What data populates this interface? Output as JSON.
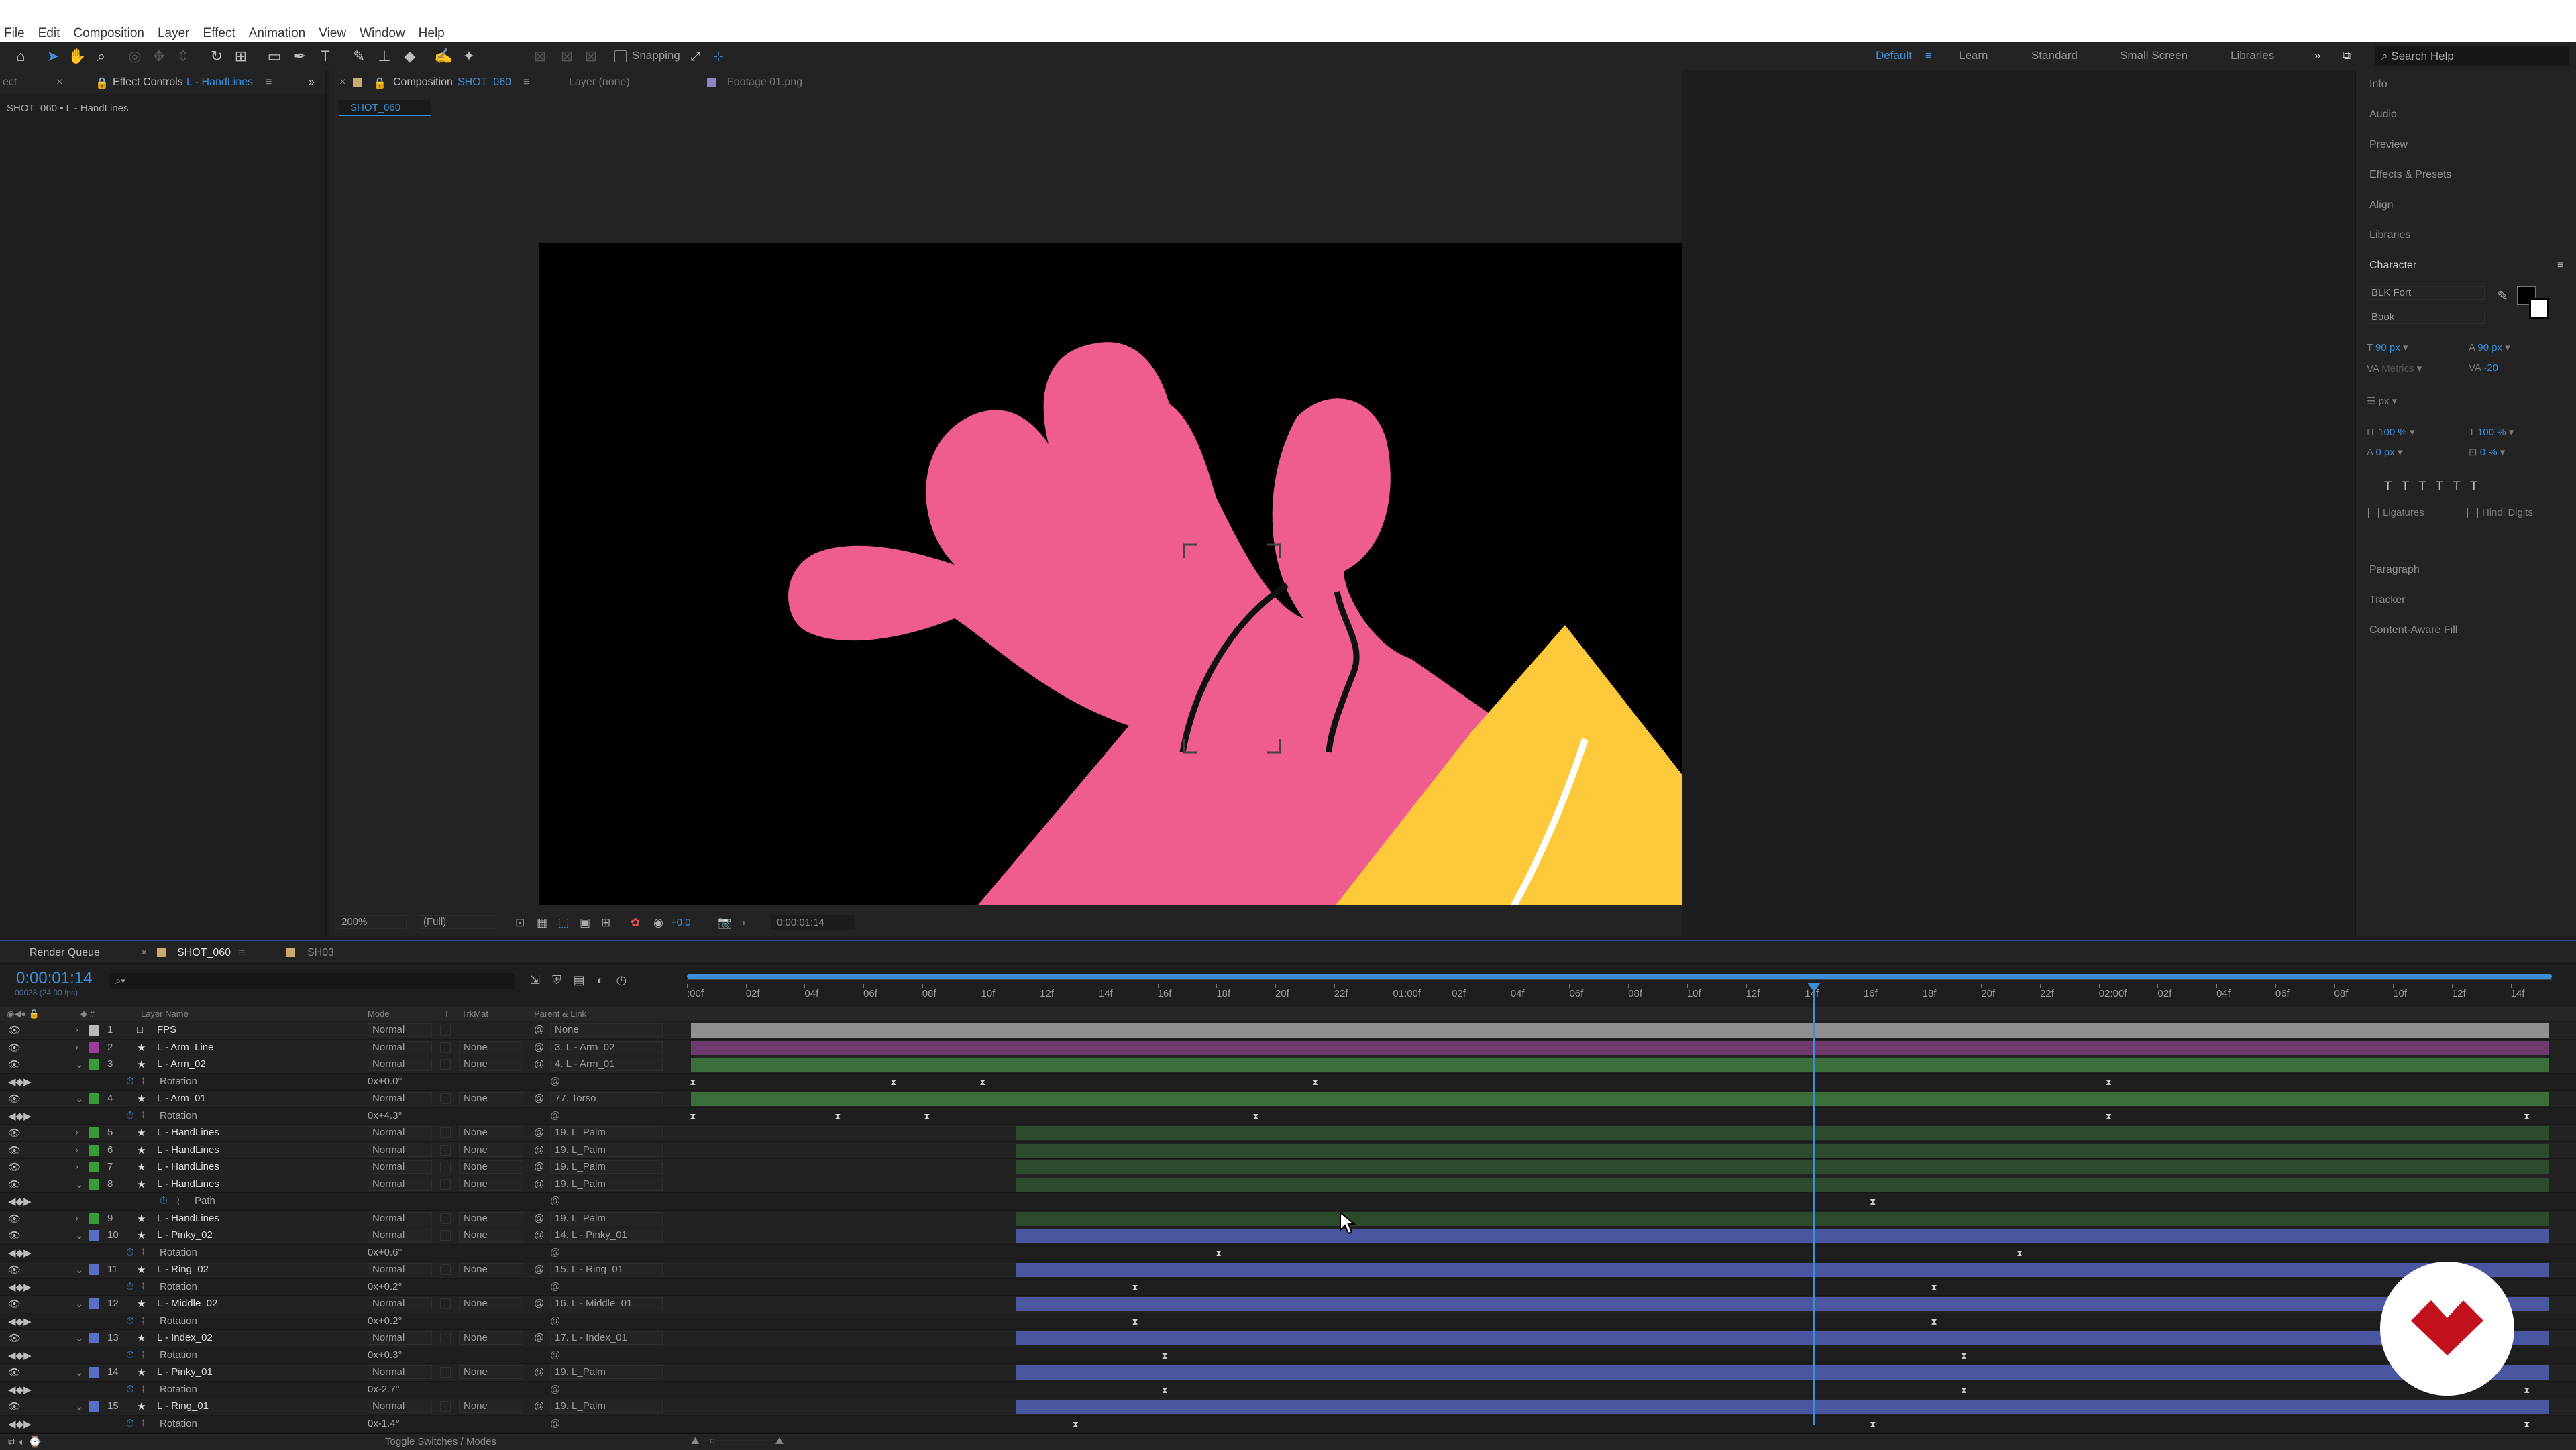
{
  "menu": [
    "File",
    "Edit",
    "Composition",
    "Layer",
    "Effect",
    "Animation",
    "View",
    "Window",
    "Help"
  ],
  "toolbar": {
    "snapping": "Snapping"
  },
  "workspaces": {
    "active": "Default",
    "items": [
      "Learn",
      "Standard",
      "Small Screen",
      "Libraries"
    ]
  },
  "search": {
    "placeholder": "Search Help"
  },
  "left": {
    "tab_prefix": "ect",
    "tab": "Effect Controls",
    "tab_layer": "L - HandLines",
    "breadcrumb": "SHOT_060 • L - HandLines"
  },
  "comp": {
    "tab_label": "Composition",
    "tab_name": "SHOT_060",
    "layer_tab": "Layer (none)",
    "footage_tab": "Footage 01.png",
    "subtab": "SHOT_060",
    "zoom": "200%",
    "quality": "(Full)",
    "exposure": "+0.0",
    "timecode": "0:00:01:14"
  },
  "right": {
    "items": [
      "Info",
      "Audio",
      "Preview",
      "Effects & Presets",
      "Align",
      "Libraries"
    ],
    "character": "Character",
    "font": "BLK Fort",
    "style": "Book",
    "size": "90 px",
    "leading": "90 px",
    "kerning": "Metrics",
    "tracking": "-20",
    "unit": "px",
    "vscale": "100 %",
    "hscale": "100 %",
    "baseline": "0 px",
    "tsume": "0 %",
    "ligatures": "Ligatures",
    "hindi": "Hindi Digits",
    "bottom": [
      "Paragraph",
      "Tracker",
      "Content-Aware Fill"
    ]
  },
  "timeline": {
    "render_queue": "Render Queue",
    "comp_tab": "SHOT_060",
    "other_tab": "SH03",
    "time": "0:00:01:14",
    "fps": "00038 (24.00 fps)",
    "headers": {
      "name": "Layer Name",
      "mode": "Mode",
      "t": "T",
      "trkmat": "TrkMat",
      "parent": "Parent & Link"
    },
    "ticks": [
      ":00f",
      "02f",
      "04f",
      "06f",
      "08f",
      "10f",
      "12f",
      "14f",
      "16f",
      "18f",
      "20f",
      "22f",
      "01:00f",
      "02f",
      "04f",
      "06f",
      "08f",
      "10f",
      "12f",
      "14f",
      "16f",
      "18f",
      "20f",
      "22f",
      "02:00f",
      "02f",
      "04f",
      "06f",
      "08f",
      "10f",
      "12f",
      "14f"
    ],
    "toggle_label": "Toggle Switches / Modes",
    "rows": [
      {
        "num": "1",
        "name": "FPS",
        "mode": "Normal",
        "trk": "",
        "parent": "None",
        "color": "#b9b9b9",
        "bar": "#8f8f8f",
        "barStart": 0,
        "type": "layer",
        "solid": true
      },
      {
        "num": "2",
        "name": "L - Arm_Line",
        "mode": "Normal",
        "trk": "None",
        "parent": "3. L - Arm_02",
        "color": "#9b3c9b",
        "bar": "#6e3a6e",
        "barStart": 0,
        "type": "layer"
      },
      {
        "num": "3",
        "name": "L - Arm_02",
        "mode": "Normal",
        "trk": "None",
        "parent": "4. L - Arm_01",
        "color": "#3a9a3a",
        "bar": "#3c6e3c",
        "barStart": 0,
        "type": "layer",
        "open": true
      },
      {
        "name": "Rotation",
        "value": "0x+0.0°",
        "type": "prop",
        "keys": [
          0.1,
          10.9,
          15.7,
          33.6,
          76.3
        ]
      },
      {
        "num": "4",
        "name": "L - Arm_01",
        "mode": "Normal",
        "trk": "None",
        "parent": "77. Torso",
        "color": "#3a9a3a",
        "bar": "#3c6e3c",
        "barStart": 0,
        "type": "layer",
        "open": true
      },
      {
        "name": "Rotation",
        "value": "0x+4.3°",
        "type": "prop",
        "keys": [
          0.1,
          7.9,
          12.7,
          30.4,
          76.3,
          98.8
        ]
      },
      {
        "num": "5",
        "name": "L - HandLines",
        "mode": "Normal",
        "trk": "None",
        "parent": "19. L_Palm",
        "color": "#3a9a3a",
        "bar": "#2d4a2d",
        "barStart": 17.5,
        "type": "layer"
      },
      {
        "num": "6",
        "name": "L - HandLines",
        "mode": "Normal",
        "trk": "None",
        "parent": "19. L_Palm",
        "color": "#3a9a3a",
        "bar": "#2d4a2d",
        "barStart": 17.5,
        "type": "layer"
      },
      {
        "num": "7",
        "name": "L - HandLines",
        "mode": "Normal",
        "trk": "None",
        "parent": "19. L_Palm",
        "color": "#3a9a3a",
        "bar": "#2d4a2d",
        "barStart": 17.5,
        "type": "layer"
      },
      {
        "num": "8",
        "name": "L - HandLines",
        "mode": "Normal",
        "trk": "None",
        "parent": "19. L_Palm",
        "color": "#3a9a3a",
        "bar": "#2d4a2d",
        "barStart": 17.5,
        "type": "layer",
        "open": true
      },
      {
        "name": "Path",
        "value": "",
        "type": "prop",
        "keys": [
          63.6
        ],
        "indent": true
      },
      {
        "num": "9",
        "name": "L - HandLines",
        "mode": "Normal",
        "trk": "None",
        "parent": "19. L_Palm",
        "color": "#3a9a3a",
        "bar": "#2d4a2d",
        "barStart": 17.5,
        "type": "layer"
      },
      {
        "num": "10",
        "name": "L - Pinky_02",
        "mode": "Normal",
        "trk": "None",
        "parent": "14. L - Pinky_01",
        "color": "#5a6ec8",
        "bar": "#4a57a0",
        "barStart": 17.5,
        "type": "layer",
        "open": true
      },
      {
        "name": "Rotation",
        "value": "0x+0.6°",
        "type": "prop",
        "keys": [
          28.4,
          71.5
        ]
      },
      {
        "num": "11",
        "name": "L - Ring_02",
        "mode": "Normal",
        "trk": "None",
        "parent": "15. L - Ring_01",
        "color": "#5a6ec8",
        "bar": "#4a57a0",
        "barStart": 17.5,
        "type": "layer",
        "open": true
      },
      {
        "name": "Rotation",
        "value": "0x+0.2°",
        "type": "prop",
        "keys": [
          23.9,
          66.9
        ]
      },
      {
        "num": "12",
        "name": "L - Middle_02",
        "mode": "Normal",
        "trk": "None",
        "parent": "16. L - Middle_01",
        "color": "#5a6ec8",
        "bar": "#4a57a0",
        "barStart": 17.5,
        "type": "layer",
        "open": true
      },
      {
        "name": "Rotation",
        "value": "0x+0.2°",
        "type": "prop",
        "keys": [
          23.9,
          66.9
        ]
      },
      {
        "num": "13",
        "name": "L - Index_02",
        "mode": "Normal",
        "trk": "None",
        "parent": "17. L - Index_01",
        "color": "#5a6ec8",
        "bar": "#4a57a0",
        "barStart": 17.5,
        "type": "layer",
        "open": true
      },
      {
        "name": "Rotation",
        "value": "0x+0.3°",
        "type": "prop",
        "keys": [
          25.5,
          68.5
        ]
      },
      {
        "num": "14",
        "name": "L - Pinky_01",
        "mode": "Normal",
        "trk": "None",
        "parent": "19. L_Palm",
        "color": "#5a6ec8",
        "bar": "#4a57a0",
        "barStart": 17.5,
        "type": "layer",
        "open": true
      },
      {
        "name": "Rotation",
        "value": "0x-2.7°",
        "type": "prop",
        "keys": [
          25.5,
          68.5,
          98.8
        ]
      },
      {
        "num": "15",
        "name": "L - Ring_01",
        "mode": "Normal",
        "trk": "None",
        "parent": "19. L_Palm",
        "color": "#5a6ec8",
        "bar": "#4a57a0",
        "barStart": 17.5,
        "type": "layer",
        "open": true
      },
      {
        "name": "Rotation",
        "value": "0x-1.4°",
        "type": "prop",
        "keys": [
          20.7,
          63.6,
          98.8
        ]
      }
    ]
  }
}
